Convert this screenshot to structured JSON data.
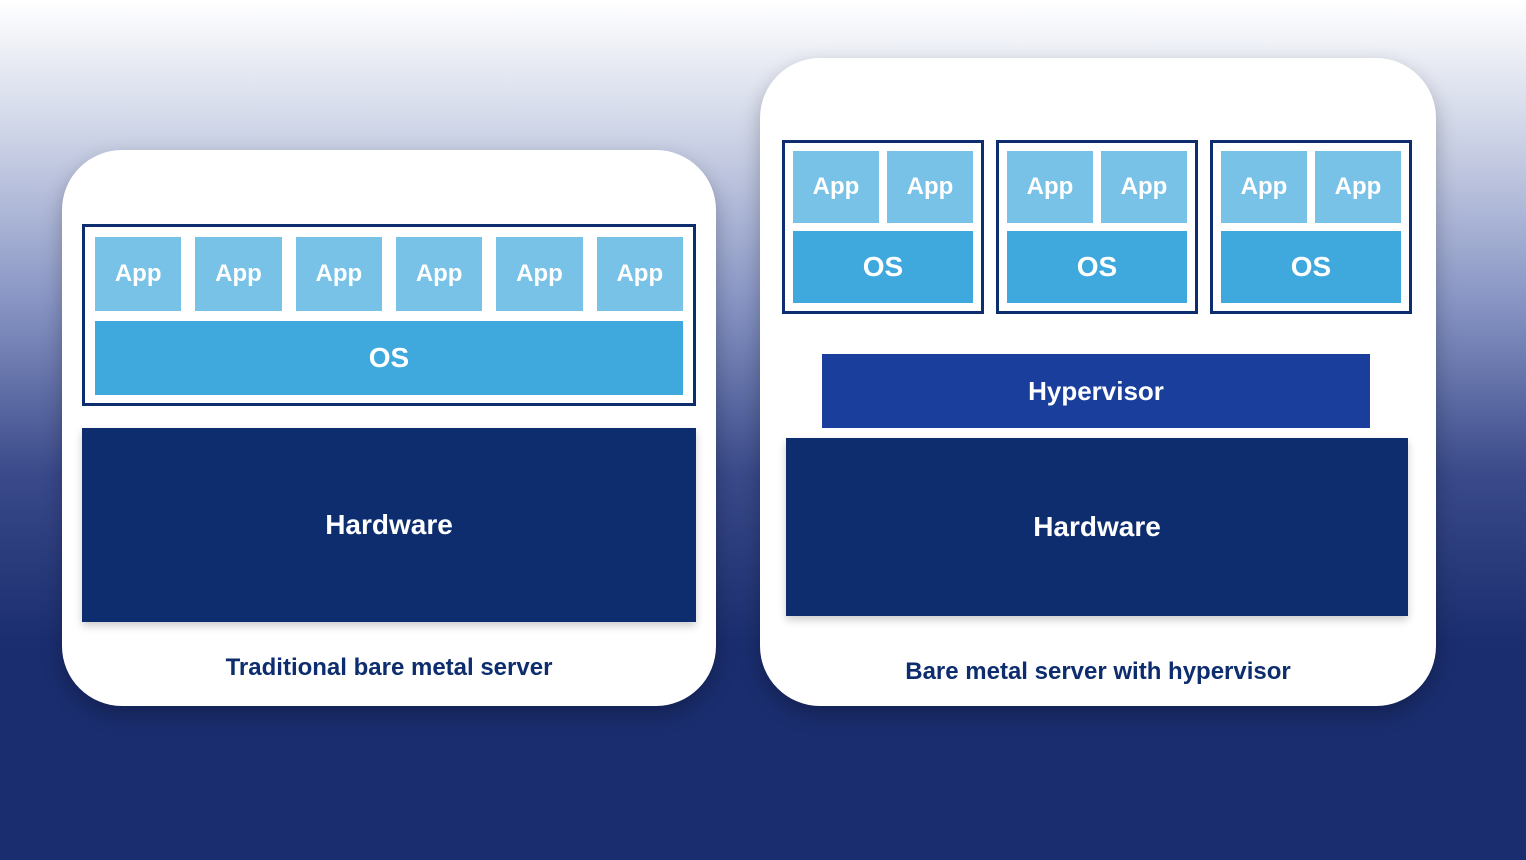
{
  "left": {
    "caption": "Traditional bare metal server",
    "hardware": "Hardware",
    "os": "OS",
    "apps": [
      "App",
      "App",
      "App",
      "App",
      "App",
      "App"
    ]
  },
  "right": {
    "caption": "Bare metal server with hypervisor",
    "hardware": "Hardware",
    "hypervisor": "Hypervisor",
    "vms": [
      {
        "os": "OS",
        "apps": [
          "App",
          "App"
        ]
      },
      {
        "os": "OS",
        "apps": [
          "App",
          "App"
        ]
      },
      {
        "os": "OS",
        "apps": [
          "App",
          "App"
        ]
      }
    ]
  },
  "colors": {
    "hardware": "#0d2d6e",
    "hypervisor": "#1a3e9c",
    "os": "#3fa9de",
    "app": "#78c2e8",
    "card": "#ffffff"
  }
}
